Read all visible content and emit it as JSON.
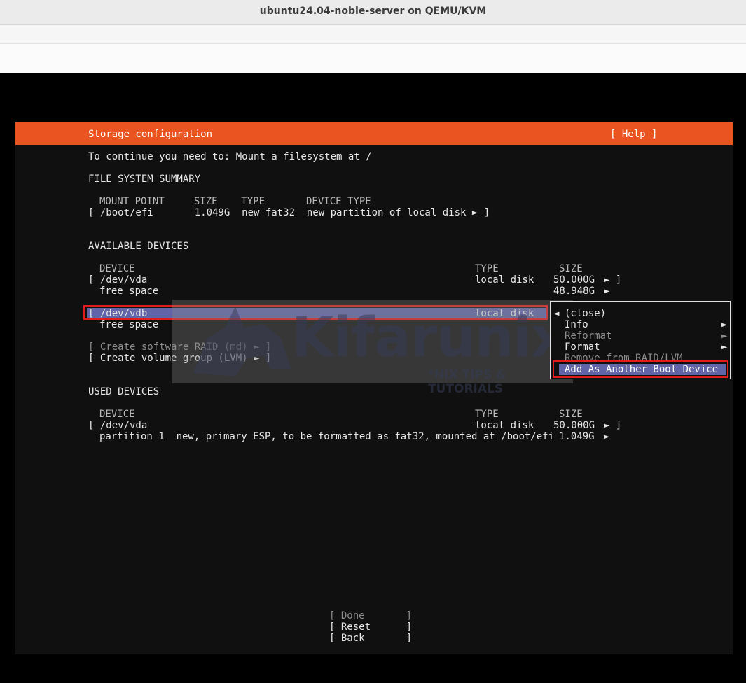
{
  "window": {
    "title": "ubuntu24.04-noble-server on QEMU/KVM"
  },
  "header": {
    "title": "Storage configuration",
    "help": "[ Help ]"
  },
  "instruction": "To continue you need to: Mount a filesystem at /",
  "fs_summary": {
    "heading": "FILE SYSTEM SUMMARY",
    "columns": "MOUNT POINT     SIZE    TYPE       DEVICE TYPE",
    "rows": [
      "[ /boot/efi       1.049G  new fat32  new partition of local disk ► ]"
    ]
  },
  "available": {
    "heading": "AVAILABLE DEVICES",
    "col_device": "DEVICE",
    "col_type": "TYPE",
    "col_size": "SIZE",
    "vda": {
      "name": "[ /dev/vda",
      "type": "local disk",
      "size": "50.000G",
      "arrow": "► ]"
    },
    "vda_free": {
      "name": "free space",
      "size": "48.948G",
      "arrow": "►"
    },
    "vdb": {
      "name": "[ /dev/vdb",
      "type": "local disk"
    },
    "vdb_free": {
      "name": "free space"
    },
    "raid": "[ Create software RAID (md) ► ]",
    "lvm": "[ Create volume group (LVM) ► ]"
  },
  "used": {
    "heading": "USED DEVICES",
    "col_device": "DEVICE",
    "col_type": "TYPE",
    "col_size": "SIZE",
    "vda": {
      "name": "[ /dev/vda",
      "type": "local disk",
      "size": "50.000G",
      "arrow": "► ]"
    },
    "part1": {
      "name": "partition 1  new, primary ESP, to be formatted as fat32, mounted at /boot/efi",
      "size": "1.049G",
      "arrow": "►"
    }
  },
  "menu": {
    "close_arrow": "◄",
    "close": "(close)",
    "items": [
      {
        "label": "Info",
        "arrow": "►"
      },
      {
        "label": "Reformat",
        "arrow": "►"
      },
      {
        "label": "Format",
        "arrow": "►"
      },
      {
        "label": "Remove from RAID/LVM"
      },
      {
        "label": "Add As Another Boot Device"
      }
    ]
  },
  "buttons": {
    "done": "[ Done       ]",
    "reset": "[ Reset      ]",
    "back": "[ Back       ]"
  },
  "watermark": {
    "brand": "Kifarunix",
    "tagline": "*NIX TIPS & TUTORIALS"
  },
  "colors": {
    "header": "#e95420",
    "selection": "#6164a6",
    "highlight_box": "#e11b1b"
  }
}
